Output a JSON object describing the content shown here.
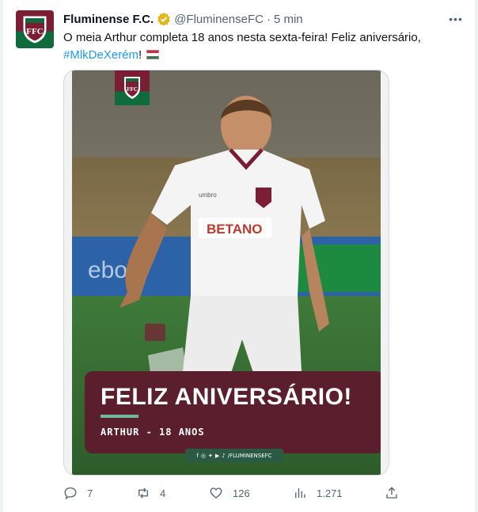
{
  "tweet": {
    "author_name": "Fluminense F.C.",
    "author_handle": "@FluminenseFC",
    "separator": "·",
    "time": "5 min",
    "more_label": "•••",
    "text": "O meia Arthur completa 18 anos nesta sexta-feira! Feliz aniversário,",
    "hashtag": "#MlkDeXerém",
    "text_suffix": "!",
    "flag_icon": "hungary-flag-icon"
  },
  "media": {
    "headline": "FELIZ ANIVERSÁRIO!",
    "subline": "ARTHUR - 18 ANOS",
    "social_handle": "/FLUMINENSEFC",
    "shirt_sponsor": "BETANO",
    "shirt_brand": "umbro",
    "colors": {
      "grena": "#7b1e34",
      "green": "#0f6b3b",
      "caption_bg": "#5b1e2c",
      "accent": "#6fb9a0"
    }
  },
  "actions": {
    "reply_count": "7",
    "retweet_count": "4",
    "like_count": "126",
    "view_count": "1.271"
  },
  "ui_colors": {
    "link": "#1d9bf0",
    "secondary": "#536471",
    "verified_gold": "#e2b719"
  }
}
